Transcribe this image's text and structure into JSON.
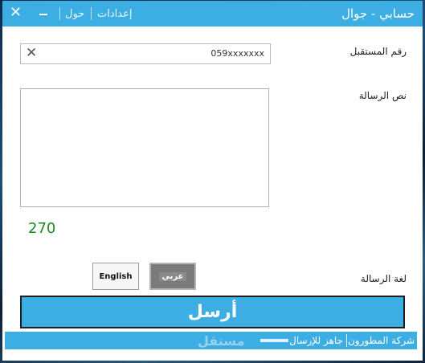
{
  "window": {
    "title": "حسابي - جوال"
  },
  "menu": {
    "settings": "إعدادات",
    "about": "حول"
  },
  "form": {
    "recipient_label": "رقم المستقبل",
    "recipient_value": "059xxxxxxx",
    "message_label": "نص الرسالة",
    "message_value": "",
    "char_counter": "270",
    "language_label": "لغة الرسالة",
    "lang_english": "English",
    "lang_arabic": "عربي",
    "selected_language": "عربي",
    "send_label": "أرسل"
  },
  "statusbar": {
    "company": "شركة المطورون",
    "status": "جاهز للإرسال",
    "watermark": "مستقل"
  },
  "colors": {
    "accent": "#3daee3",
    "counter": "#1d8a1d",
    "selected_button": "#7a7a7a"
  }
}
